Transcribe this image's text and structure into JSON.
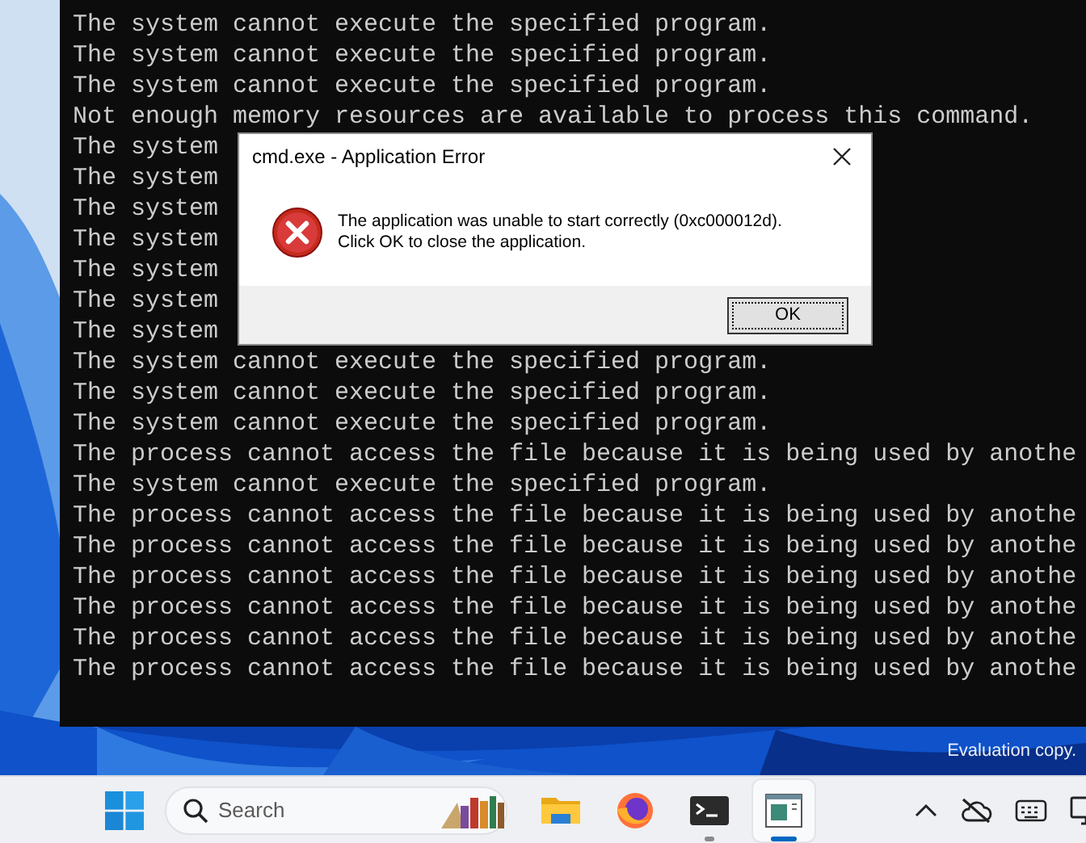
{
  "console": {
    "lines": [
      {
        "text": "The system cannot execute the specified program."
      },
      {
        "text": "The system cannot execute the specified program."
      },
      {
        "text": "The system cannot execute the specified program."
      },
      {
        "text": "Not enough memory resources are available to process this command."
      },
      {
        "text": "The system"
      },
      {
        "text": "The system"
      },
      {
        "text": "The system"
      },
      {
        "text": "The system"
      },
      {
        "text": "The system"
      },
      {
        "text": "The system"
      },
      {
        "text": "The system"
      },
      {
        "text": "The system cannot execute the specified program."
      },
      {
        "text": "The system cannot execute the specified program."
      },
      {
        "text": "The system cannot execute the specified program."
      },
      {
        "text": "The process cannot access the file because it is being used by anothe"
      },
      {
        "text": "The system cannot execute the specified program."
      },
      {
        "text": "The process cannot access the file because it is being used by anothe"
      },
      {
        "text": "The process cannot access the file because it is being used by anothe"
      },
      {
        "text": "The process cannot access the file because it is being used by anothe"
      },
      {
        "text": "The process cannot access the file because it is being used by anothe"
      },
      {
        "text": "The process cannot access the file because it is being used by anothe"
      },
      {
        "text": "The process cannot access the file because it is being used by anothe"
      }
    ]
  },
  "dialog": {
    "title": "cmd.exe - Application Error",
    "message": "The application was unable to start correctly (0xc000012d).\nClick OK to close the application.",
    "buttons": [
      "OK"
    ]
  },
  "desktop": {
    "watermark": "Evaluation copy."
  },
  "taskbar": {
    "search": {
      "placeholder": "Search"
    },
    "apps": [
      {
        "kind": "folder",
        "running": false,
        "selected": false
      },
      {
        "kind": "browser",
        "running": false,
        "selected": false
      },
      {
        "kind": "terminal",
        "running": true,
        "selected": false
      },
      {
        "kind": "window",
        "running": true,
        "selected": true
      }
    ]
  }
}
